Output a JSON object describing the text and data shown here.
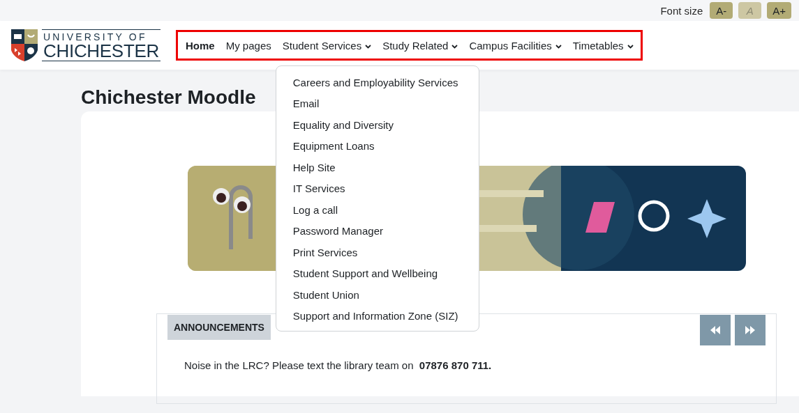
{
  "font_size": {
    "label": "Font size",
    "buttons": [
      {
        "label": "A-",
        "disabled": false
      },
      {
        "label": "A",
        "disabled": true
      },
      {
        "label": "A+",
        "disabled": false
      }
    ]
  },
  "logo": {
    "line_1": "UNIVERSITY OF",
    "line_2": "CHICHESTER"
  },
  "nav": [
    {
      "label": "Home",
      "selected": true,
      "kind": "link"
    },
    {
      "label": "My pages",
      "selected": false,
      "kind": "link"
    },
    {
      "label": "Student Services",
      "selected": false,
      "kind": "menu",
      "menu": [
        "Careers and Employability Services",
        "Email",
        "Equality and Diversity",
        "Equipment Loans",
        "Help Site",
        "IT Services",
        "Log a call",
        "Password Manager",
        "Print Services",
        "Student Support and Wellbeing",
        "Student Union",
        "Support and Information Zone (SIZ)"
      ]
    },
    {
      "label": "Study Related",
      "selected": false,
      "kind": "menu"
    },
    {
      "label": "Campus Facilities",
      "selected": false,
      "kind": "menu"
    },
    {
      "label": "Timetables",
      "selected": false,
      "kind": "menu"
    }
  ],
  "page_title": "Chichester Moodle",
  "announcements": {
    "title": "ANNOUNCEMENTS",
    "message": "Noise in the LRC? Please text the library team on  **07876 870 711.**"
  }
}
